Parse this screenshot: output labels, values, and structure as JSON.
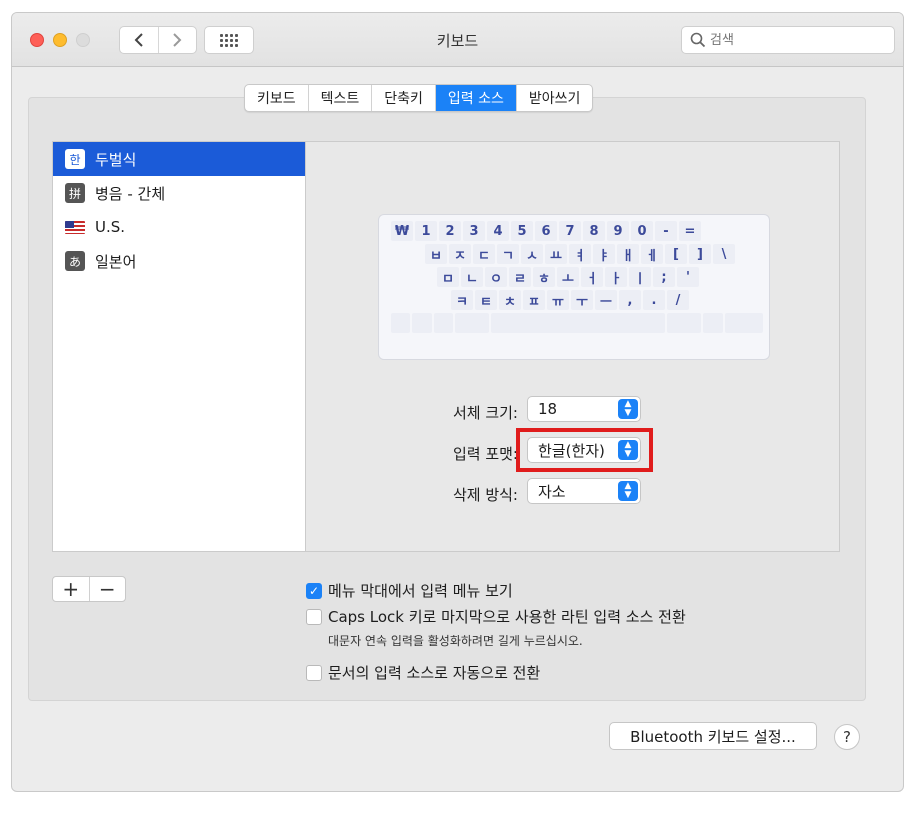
{
  "window": {
    "title": "키보드"
  },
  "toolbar": {
    "search_placeholder": "검색"
  },
  "tabs": [
    {
      "label": "키보드",
      "active": false
    },
    {
      "label": "텍스트",
      "active": false
    },
    {
      "label": "단축키",
      "active": false
    },
    {
      "label": "입력 소스",
      "active": true
    },
    {
      "label": "받아쓰기",
      "active": false
    }
  ],
  "sources": [
    {
      "label": "두벌식",
      "glyph": "한",
      "selected": true
    },
    {
      "label": "병음 - 간체",
      "glyph": "拼",
      "selected": false
    },
    {
      "label": "U.S.",
      "glyph": "flag-us",
      "selected": false
    },
    {
      "label": "일본어",
      "glyph": "あ",
      "selected": false
    }
  ],
  "keyboard": {
    "rows": [
      [
        "₩",
        "1",
        "2",
        "3",
        "4",
        "5",
        "6",
        "7",
        "8",
        "9",
        "0",
        "-",
        "="
      ],
      [
        "ㅂ",
        "ㅈ",
        "ㄷ",
        "ㄱ",
        "ㅅ",
        "ㅛ",
        "ㅕ",
        "ㅑ",
        "ㅐ",
        "ㅔ",
        "[",
        "]",
        "\\"
      ],
      [
        "ㅁ",
        "ㄴ",
        "ㅇ",
        "ㄹ",
        "ㅎ",
        "ㅗ",
        "ㅓ",
        "ㅏ",
        "ㅣ",
        ";",
        "'"
      ],
      [
        "ㅋ",
        "ㅌ",
        "ㅊ",
        "ㅍ",
        "ㅠ",
        "ㅜ",
        "ㅡ",
        ",",
        ".",
        "/"
      ]
    ]
  },
  "form": {
    "font_size_label": "서체 크기:",
    "font_size_value": "18",
    "input_format_label": "입력 포맷:",
    "input_format_value": "한글(한자)",
    "delete_method_label": "삭제 방식:",
    "delete_method_value": "자소"
  },
  "buttons": {
    "add": "+",
    "remove": "−",
    "bluetooth": "Bluetooth 키보드 설정...",
    "help": "?"
  },
  "options": {
    "menu_bar": {
      "label": "메뉴 막대에서 입력 메뉴 보기",
      "checked": true
    },
    "caps_lock": {
      "label": "Caps Lock 키로 마지막으로 사용한 라틴 입력 소스 전환",
      "checked": false
    },
    "caps_hint": "대문자 연속 입력을 활성화하려면 길게 누르십시오.",
    "auto_switch": {
      "label": "문서의 입력 소스로 자동으로 전환",
      "checked": false
    }
  },
  "colors": {
    "accent": "#1b82f7",
    "selection": "#1b5bd8",
    "highlight": "#e01c1c"
  }
}
